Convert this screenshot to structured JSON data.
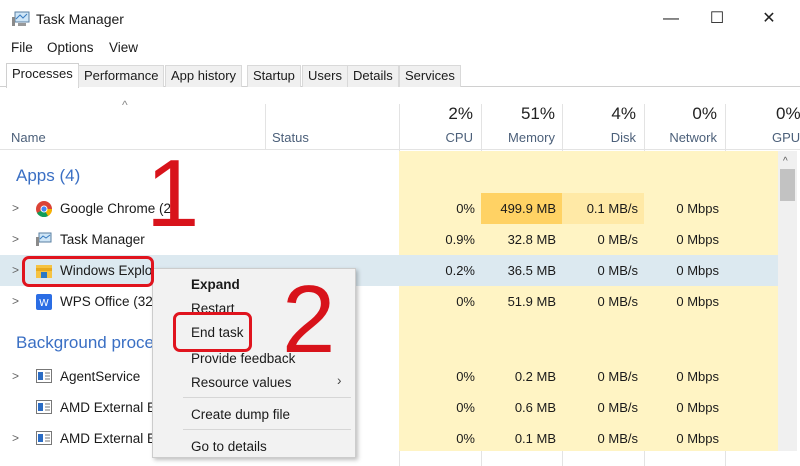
{
  "window": {
    "title": "Task Manager",
    "minimize": "—",
    "maximize": "☐",
    "close": "✕"
  },
  "menu": [
    "File",
    "Options",
    "View"
  ],
  "tabs": [
    "Processes",
    "Performance",
    "App history",
    "Startup",
    "Users",
    "Details",
    "Services"
  ],
  "columns": {
    "name": "Name",
    "status": "Status",
    "cpu": {
      "pct": "2%",
      "label": "CPU"
    },
    "memory": {
      "pct": "51%",
      "label": "Memory"
    },
    "disk": {
      "pct": "4%",
      "label": "Disk"
    },
    "network": {
      "pct": "0%",
      "label": "Network"
    },
    "gpu": {
      "pct": "0%",
      "label": "GPU"
    }
  },
  "groups": {
    "apps": "Apps (4)",
    "background": "Background proce"
  },
  "apps": [
    {
      "name": "Google Chrome (24",
      "cpu": "0%",
      "memory": "499.9 MB",
      "disk": "0.1 MB/s",
      "network": "0 Mbps"
    },
    {
      "name": "Task Manager",
      "cpu": "0.9%",
      "memory": "32.8 MB",
      "disk": "0 MB/s",
      "network": "0 Mbps"
    },
    {
      "name": "Windows Explo",
      "cpu": "0.2%",
      "memory": "36.5 MB",
      "disk": "0 MB/s",
      "network": "0 Mbps"
    },
    {
      "name": "WPS Office (32",
      "cpu": "0%",
      "memory": "51.9 MB",
      "disk": "0 MB/s",
      "network": "0 Mbps"
    }
  ],
  "background": [
    {
      "name": "AgentService",
      "cpu": "0%",
      "memory": "0.2 MB",
      "disk": "0 MB/s",
      "network": "0 Mbps"
    },
    {
      "name": "AMD External E",
      "cpu": "0%",
      "memory": "0.6 MB",
      "disk": "0 MB/s",
      "network": "0 Mbps"
    },
    {
      "name": "AMD External E",
      "cpu": "0%",
      "memory": "0.1 MB",
      "disk": "0 MB/s",
      "network": "0 Mbps"
    }
  ],
  "context_menu": {
    "expand": "Expand",
    "restart": "Restart",
    "end_task": "End task",
    "feedback": "Provide feedback",
    "resource": "Resource values",
    "dump": "Create dump file",
    "details": "Go to details"
  },
  "annotations": {
    "step1": "1",
    "step2": "2"
  },
  "colors": {
    "accent": "#3a6fc4",
    "annotation": "#e0141e",
    "heat": "#fff4c4",
    "heat_high": "#ffd264",
    "selected": "#dce9f0"
  }
}
